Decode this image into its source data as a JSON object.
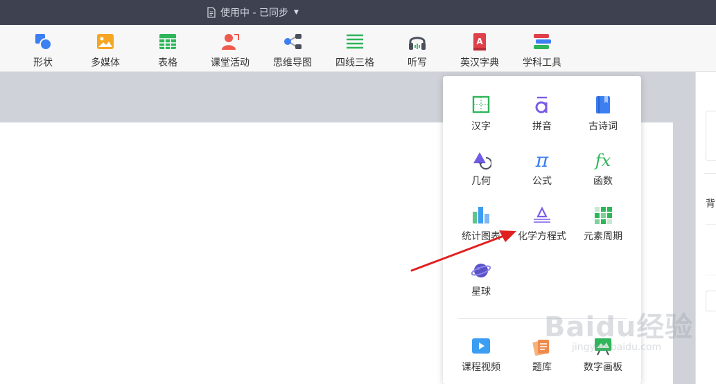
{
  "titlebar": {
    "doc_status": "使用中 - 已同步"
  },
  "toolbar": {
    "items": [
      {
        "label": "形状",
        "icon": "shape-icon"
      },
      {
        "label": "多媒体",
        "icon": "media-icon"
      },
      {
        "label": "表格",
        "icon": "table-icon"
      },
      {
        "label": "课堂活动",
        "icon": "classroom-activity-icon"
      },
      {
        "label": "思维导图",
        "icon": "mindmap-icon"
      },
      {
        "label": "四线三格",
        "icon": "four-line-grid-icon"
      },
      {
        "label": "听写",
        "icon": "dictation-headphones-icon"
      },
      {
        "label": "英汉字典",
        "icon": "dictionary-icon"
      },
      {
        "label": "学科工具",
        "icon": "subject-tools-icon"
      }
    ]
  },
  "subject_tools_menu": {
    "items": [
      {
        "label": "汉字",
        "icon": "hanzi-icon"
      },
      {
        "label": "拼音",
        "icon": "pinyin-icon"
      },
      {
        "label": "古诗词",
        "icon": "poetry-book-icon"
      },
      {
        "label": "几何",
        "icon": "geometry-icon"
      },
      {
        "label": "公式",
        "icon": "formula-pi-icon"
      },
      {
        "label": "函数",
        "icon": "function-fx-icon"
      },
      {
        "label": "统计图表",
        "icon": "statistics-chart-icon"
      },
      {
        "label": "化学方程式",
        "icon": "chemical-equation-icon"
      },
      {
        "label": "元素周期",
        "icon": "periodic-table-icon"
      },
      {
        "label": "星球",
        "icon": "planet-icon"
      }
    ],
    "extra_items": [
      {
        "label": "课程视频",
        "icon": "course-video-icon"
      },
      {
        "label": "题库",
        "icon": "question-bank-icon"
      },
      {
        "label": "数字画板",
        "icon": "digital-drawing-board-icon"
      }
    ]
  },
  "right_panel": {
    "label": "背"
  },
  "watermark": {
    "logo": "Baidu经验",
    "sub": "jingyan.baidu.com"
  },
  "colors": {
    "titlebar": "#3d4150",
    "toolbar": "#f7f7f8",
    "canvas": "#cfd2d8",
    "arrow": "#e02020"
  }
}
